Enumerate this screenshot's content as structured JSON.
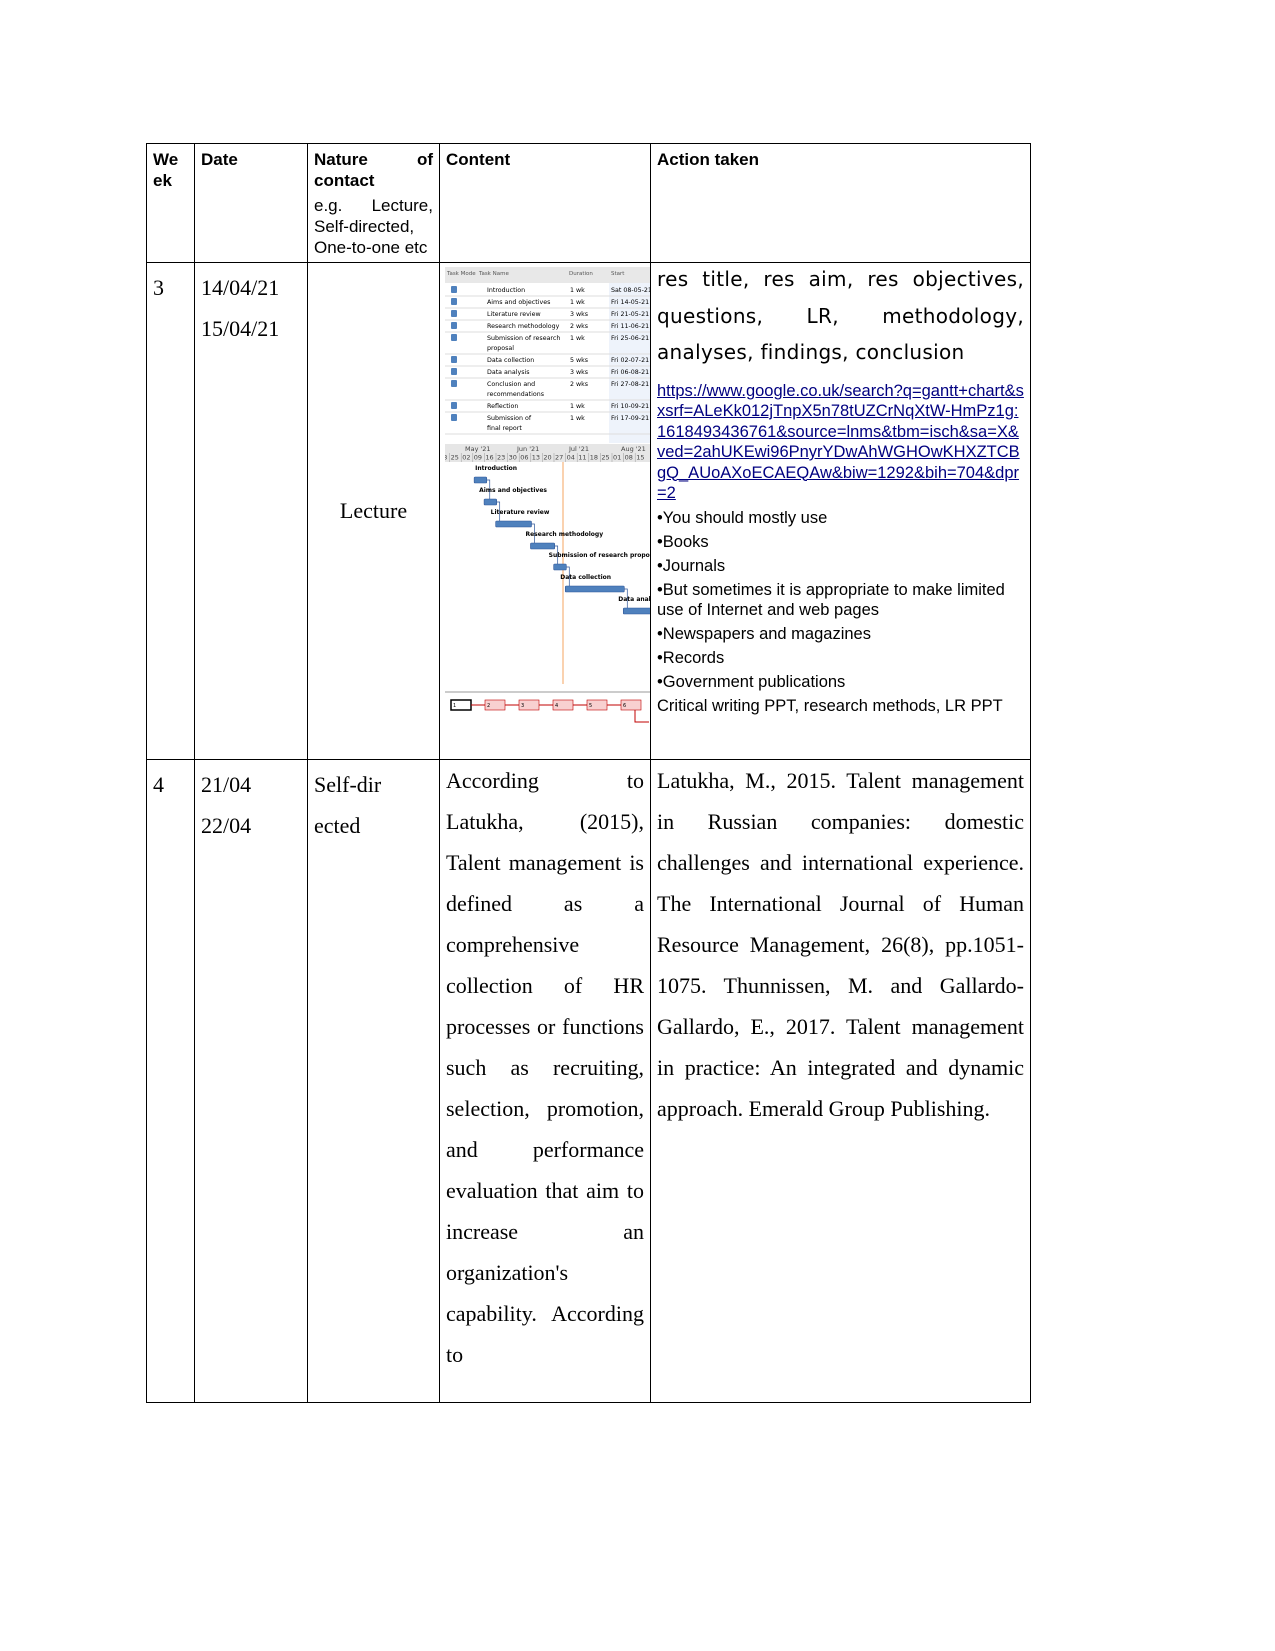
{
  "header": {
    "week": "We ek",
    "date": "Date",
    "nature_a": "Nature",
    "nature_b": "of",
    "nature_c": "contact",
    "nature_example": "e.g. Lecture, Self-directed, One-to-one etc",
    "content": "Content",
    "action": "Action taken"
  },
  "rows": [
    {
      "week": "3",
      "dates": [
        "14/04/21",
        "15/04/21"
      ],
      "nature": "Lecture",
      "gantt": {
        "columns": [
          "Task Mode",
          "Task Name",
          "Duration",
          "Start"
        ],
        "tasks": [
          {
            "name": "Introduction",
            "duration": "1 wk",
            "start": "Sat 08-05-21"
          },
          {
            "name": "Aims and objectives",
            "duration": "1 wk",
            "start": "Fri 14-05-21"
          },
          {
            "name": "Literature review",
            "duration": "3 wks",
            "start": "Fri 21-05-21"
          },
          {
            "name": "Research methodology",
            "duration": "2 wks",
            "start": "Fri 11-06-21"
          },
          {
            "name": "Submission of research proposal",
            "duration": "1 wk",
            "start": "Fri 25-06-21"
          },
          {
            "name": "Data collection",
            "duration": "5 wks",
            "start": "Fri 02-07-21"
          },
          {
            "name": "Data analysis",
            "duration": "3 wks",
            "start": "Fri 06-08-21"
          },
          {
            "name": "Conclusion and recommendations",
            "duration": "2 wks",
            "start": "Fri 27-08-21"
          },
          {
            "name": "Reflection",
            "duration": "1 wk",
            "start": "Fri 10-09-21"
          },
          {
            "name": "Submission of final report",
            "duration": "1 wk",
            "start": "Fri 17-09-21"
          }
        ],
        "months": [
          "May '21",
          "Jun '21",
          "Jul '21",
          "Aug '21"
        ],
        "weeks": [
          "18",
          "25",
          "02",
          "09",
          "16",
          "23",
          "30",
          "06",
          "13",
          "20",
          "27",
          "04",
          "11",
          "18",
          "25",
          "01",
          "08",
          "15"
        ],
        "network_nodes": [
          "1",
          "2",
          "3",
          "4",
          "5",
          "6"
        ],
        "bar_color": "#4f81bd",
        "today_line_color": "#f4a460",
        "node_color": "#c00000"
      },
      "action": {
        "summary": "res title, res aim, res objectives, questions, LR, methodology, analyses, findings, conclusion",
        "link": "https://www.google.co.uk/search?q=gantt+chart&sxsrf=ALeKk012jTnpX5n78tUZCrNqXtW-HmPz1g:1618493436761&source=lnms&tbm=isch&sa=X&ved=2ahUKEwi96PnyrYDwAhWGHOwKHXZTCBgQ_AUoAXoECAEQAw&biw=1292&bih=704&dpr=2",
        "bullets": [
          "•You should mostly use",
          "•Books",
          "•Journals",
          "•But sometimes it is appropriate to make limited use of Internet and web pages",
          "•Newspapers and magazines",
          "•Records",
          "•Government publications"
        ],
        "note": "Critical writing PPT, research methods, LR PPT"
      }
    },
    {
      "week": "4",
      "dates": [
        "21/04",
        "22/04"
      ],
      "nature": "Self-directed",
      "content": "According to Latukha, (2015), Talent management is defined as a comprehensive collection of HR processes or functions such as recruiting, selection, promotion, and performance evaluation that aim to increase an organization's capability. According to",
      "action": "Latukha, M., 2015. Talent management in Russian companies: domestic challenges and international experience. The International Journal of Human Resource Management, 26(8), pp.1051-1075. Thunnissen, M. and Gallardo-Gallardo, E., 2017. Talent management in practice: An integrated and dynamic approach. Emerald Group Publishing."
    }
  ]
}
